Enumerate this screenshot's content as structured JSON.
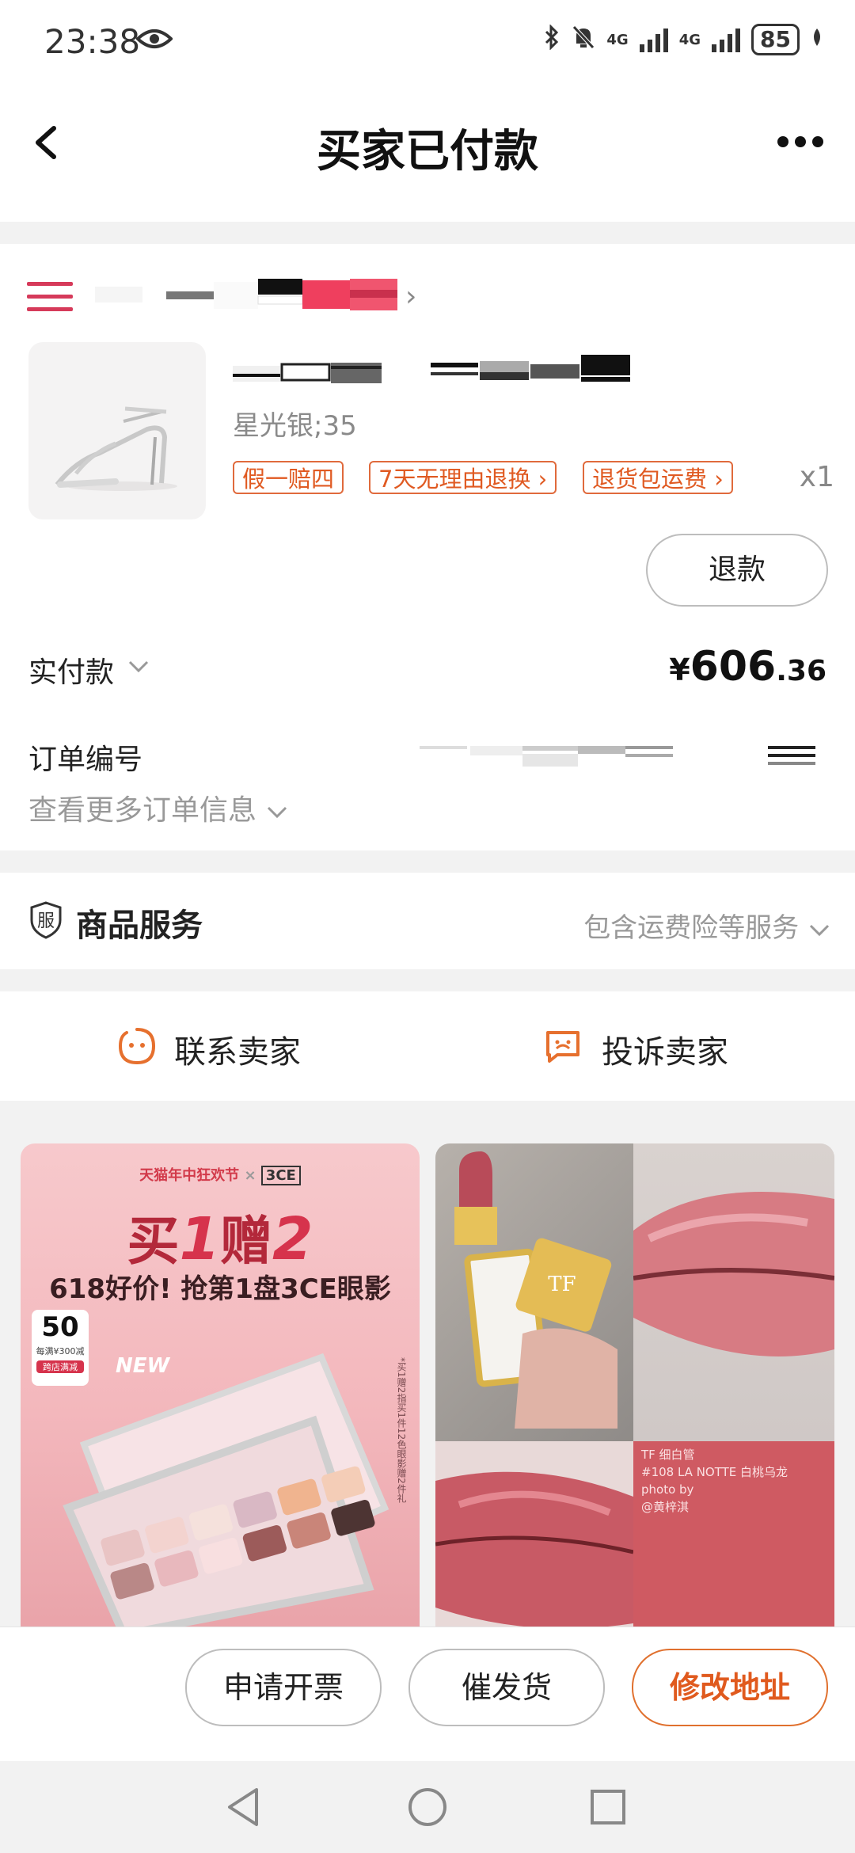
{
  "status_bar": {
    "time": "23:38",
    "network1": "4G",
    "network2": "4G",
    "battery": "85"
  },
  "header": {
    "title": "买家已付款"
  },
  "product": {
    "variant": "星光银;35",
    "tags": [
      "假一赔四",
      "7天无理由退换 ›",
      "退货包运费 ›"
    ],
    "quantity": "x1",
    "refund_label": "退款"
  },
  "payment": {
    "label": "实付款",
    "currency": "¥",
    "amount_int": "606",
    "amount_dec": ".36"
  },
  "order": {
    "number_label": "订单编号",
    "more_info": "查看更多订单信息"
  },
  "service": {
    "icon_text": "服",
    "title": "商品服务",
    "desc": "包含运费险等服务"
  },
  "contact": {
    "seller_label": "联系卖家",
    "complain_label": "投诉卖家"
  },
  "ad1": {
    "brand": "天猫年中狂欢节",
    "logo": "3CE",
    "headline_a": "买",
    "headline_b": "1",
    "headline_c": "赠",
    "headline_d": "2",
    "subline": "618好价! 抢第1盘3CE眼影",
    "coupon_amount": "50",
    "coupon_line1": "每满¥300减",
    "coupon_line2": "跨店满减",
    "badge": "NEW",
    "side_note": "*买1赠2指买1件12色眼影赠2件礼"
  },
  "ad2": {
    "line1": "TF 细白管",
    "line2": "#108 LA NOTTE 白桃乌龙",
    "line3": "photo by",
    "line4": "@黄梓淇",
    "cap_logo": "TF"
  },
  "bottom_bar": {
    "invoice": "申请开票",
    "urge": "催发货",
    "modify_address": "修改地址"
  },
  "colors": {
    "accent": "#e05a1e",
    "brand_red": "#d63a5a"
  }
}
